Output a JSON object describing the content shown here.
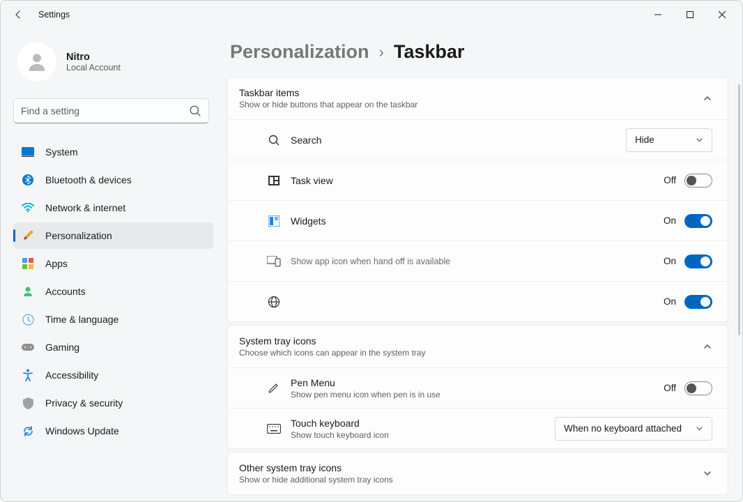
{
  "app_title": "Settings",
  "user": {
    "name": "Nitro",
    "subtitle": "Local Account"
  },
  "search": {
    "placeholder": "Find a setting"
  },
  "nav": {
    "items": [
      {
        "key": "system",
        "label": "System"
      },
      {
        "key": "bluetooth",
        "label": "Bluetooth & devices"
      },
      {
        "key": "network",
        "label": "Network & internet"
      },
      {
        "key": "personalization",
        "label": "Personalization"
      },
      {
        "key": "apps",
        "label": "Apps"
      },
      {
        "key": "accounts",
        "label": "Accounts"
      },
      {
        "key": "time",
        "label": "Time & language"
      },
      {
        "key": "gaming",
        "label": "Gaming"
      },
      {
        "key": "accessibility",
        "label": "Accessibility"
      },
      {
        "key": "privacy",
        "label": "Privacy & security"
      },
      {
        "key": "update",
        "label": "Windows Update"
      }
    ],
    "active": "personalization"
  },
  "breadcrumb": {
    "parent": "Personalization",
    "current": "Taskbar"
  },
  "sections": {
    "taskbar_items": {
      "title": "Taskbar items",
      "subtitle": "Show or hide buttons that appear on the taskbar",
      "expanded": true,
      "rows": {
        "search": {
          "label": "Search",
          "control_type": "select",
          "value": "Hide"
        },
        "taskview": {
          "label": "Task view",
          "control_type": "toggle",
          "state_label": "Off",
          "on": false
        },
        "widgets": {
          "label": "Widgets",
          "control_type": "toggle",
          "state_label": "On",
          "on": true
        },
        "handoff": {
          "label": "Show app icon when hand off is available",
          "control_type": "toggle",
          "state_label": "On",
          "on": true,
          "muted": true
        },
        "globe": {
          "label": "",
          "control_type": "toggle",
          "state_label": "On",
          "on": true
        }
      }
    },
    "system_tray": {
      "title": "System tray icons",
      "subtitle": "Choose which icons can appear in the system tray",
      "expanded": true,
      "rows": {
        "pen": {
          "label": "Pen Menu",
          "sub": "Show pen menu icon when pen is in use",
          "control_type": "toggle",
          "state_label": "Off",
          "on": false
        },
        "touch": {
          "label": "Touch keyboard",
          "sub": "Show touch keyboard icon",
          "control_type": "select",
          "value": "When no keyboard attached"
        }
      }
    },
    "other_tray": {
      "title": "Other system tray icons",
      "subtitle": "Show or hide additional system tray icons",
      "expanded": false
    }
  }
}
